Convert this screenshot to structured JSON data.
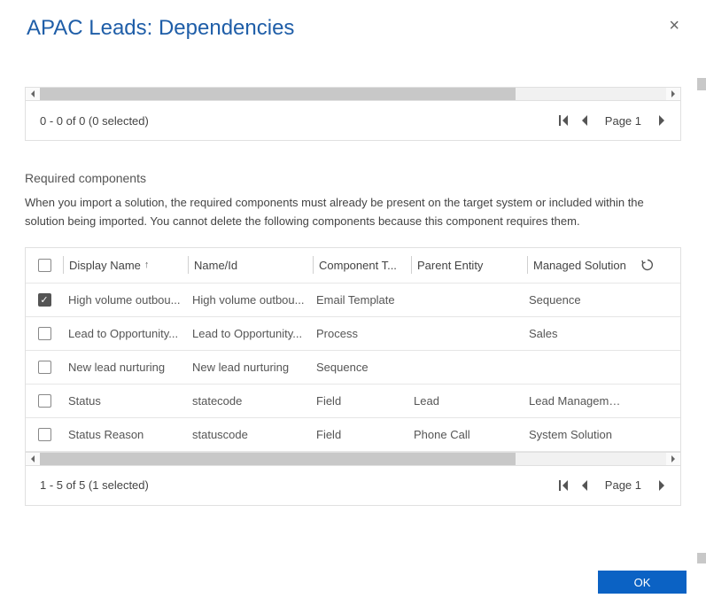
{
  "header": {
    "title": "APAC Leads: Dependencies"
  },
  "topPager": {
    "status": "0 - 0 of 0 (0 selected)",
    "pageLabel": "Page 1"
  },
  "section": {
    "heading": "Required components",
    "description": "When you import a solution, the required components must already be present on the target system or included within the solution being imported. You cannot delete the following components because this component requires them."
  },
  "grid": {
    "columns": {
      "display": "Display Name",
      "name": "Name/Id",
      "ctype": "Component T...",
      "parent": "Parent Entity",
      "managed": "Managed Solution"
    },
    "rows": [
      {
        "checked": true,
        "display": "High volume outbou...",
        "name": "High volume outbou...",
        "ctype": "Email Template",
        "parent": "",
        "managed": "Sequence"
      },
      {
        "checked": false,
        "display": "Lead to Opportunity...",
        "name": "Lead to Opportunity...",
        "ctype": "Process",
        "parent": "",
        "managed": "Sales"
      },
      {
        "checked": false,
        "display": "New lead nurturing",
        "name": "New lead nurturing",
        "ctype": "Sequence",
        "parent": "",
        "managed": ""
      },
      {
        "checked": false,
        "display": "Status",
        "name": "statecode",
        "ctype": "Field",
        "parent": "Lead",
        "managed": "Lead Management"
      },
      {
        "checked": false,
        "display": "Status Reason",
        "name": "statuscode",
        "ctype": "Field",
        "parent": "Phone Call",
        "managed": "System Solution"
      }
    ]
  },
  "bottomPager": {
    "status": "1 - 5 of 5 (1 selected)",
    "pageLabel": "Page 1"
  },
  "footer": {
    "ok": "OK"
  },
  "hscrollThumbPct": 76
}
